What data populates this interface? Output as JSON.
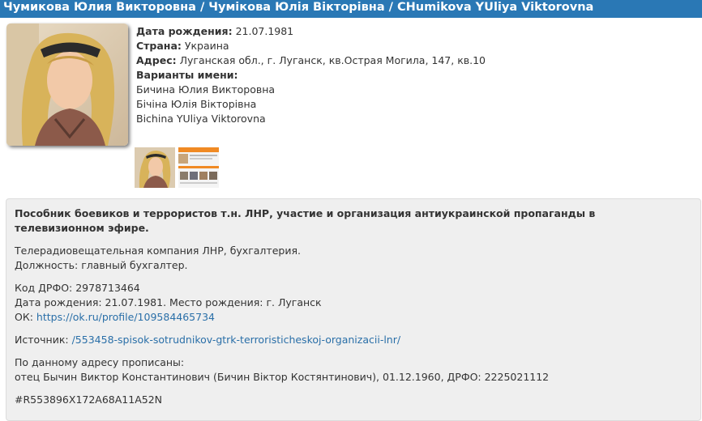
{
  "header": {
    "title": "Чумикова Юлия Викторовна / Чумікова Юлія Вікторівна / CHumikova YUliya Viktorovna"
  },
  "profile": {
    "birth_label": "Дата рождения:",
    "birth_value": "21.07.1981",
    "country_label": "Страна:",
    "country_value": "Украина",
    "address_label": "Адрес:",
    "address_value": "Луганская обл., г. Луганск, кв.Острая Могила, 147, кв.10",
    "variants_label": "Варианты имени:",
    "variants": [
      "Бичина Юлия Викторовна",
      "Бічіна Юлія Вікторівна",
      "Bichina YUliya Viktorovna"
    ]
  },
  "details": {
    "headline": "Пособник боевиков и террористов т.н. ЛНР, участие и организация антиукраинской пропаганды в телевизионном эфире.",
    "work_line1": "Телерадиовещательная компания ЛНР, бухгалтерия.",
    "work_line2": "Должность: главный бухгалтер.",
    "drfo_line": "Код ДРФО: 2978713464",
    "birth_line": "Дата рождения: 21.07.1981. Место рождения: г. Луганск",
    "ok_label": "ОК:",
    "ok_link": "https://ok.ru/profile/109584465734",
    "source_label": "Источник:",
    "source_link": "/553458-spisok-sotrudnikov-gtrk-terroristicheskoj-organizacii-lnr/",
    "registered_label": "По данному адресу прописаны:",
    "registered_person": "отец Бычин Виктор Константинович (Бичин Віктор Костянтинович), 01.12.1960, ДРФО: 2225021112",
    "hash": "#R553896X172A68A11A52N"
  }
}
